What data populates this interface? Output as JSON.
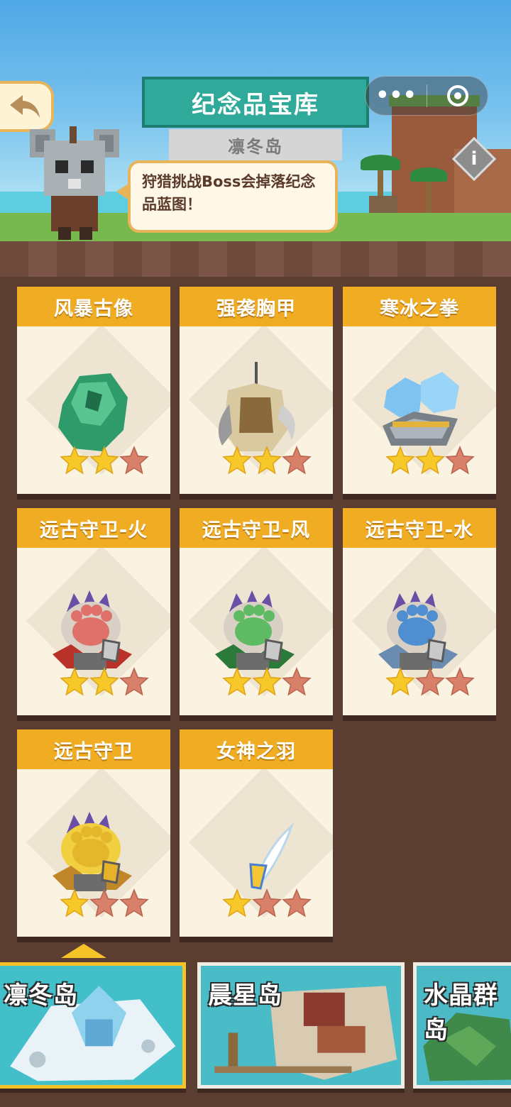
{
  "header": {
    "title": "纪念品宝库",
    "subtitle": "凛冬岛",
    "capsule_more": "•••",
    "info": "i"
  },
  "speech": "狩猎挑战Boss会掉落纪念品蓝图！",
  "cards": [
    {
      "name": "风暴古像",
      "stars": 2,
      "max_stars": 3,
      "icon": "storm-statue-icon"
    },
    {
      "name": "强袭胸甲",
      "stars": 2,
      "max_stars": 3,
      "icon": "assault-armor-icon"
    },
    {
      "name": "寒冰之拳",
      "stars": 2,
      "max_stars": 3,
      "icon": "ice-fist-icon"
    },
    {
      "name": "远古守卫-火",
      "stars": 2,
      "max_stars": 3,
      "icon": "guardian-paw-fire-icon"
    },
    {
      "name": "远古守卫-风",
      "stars": 2,
      "max_stars": 3,
      "icon": "guardian-paw-wind-icon"
    },
    {
      "name": "远古守卫-水",
      "stars": 1,
      "max_stars": 3,
      "icon": "guardian-paw-water-icon"
    },
    {
      "name": "远古守卫",
      "stars": 1,
      "max_stars": 3,
      "icon": "guardian-paw-gold-icon"
    },
    {
      "name": "女神之羽",
      "stars": 1,
      "max_stars": 3,
      "icon": "goddess-feather-icon"
    }
  ],
  "islands": [
    {
      "name": "凛冬岛",
      "active": true
    },
    {
      "name": "晨星岛",
      "active": false
    },
    {
      "name": "水晶群岛",
      "active": false
    }
  ],
  "colors": {
    "star_on": "#f7c928",
    "star_off": "#d9806a",
    "header": "#f0ad23",
    "banner": "#2ea99a"
  }
}
